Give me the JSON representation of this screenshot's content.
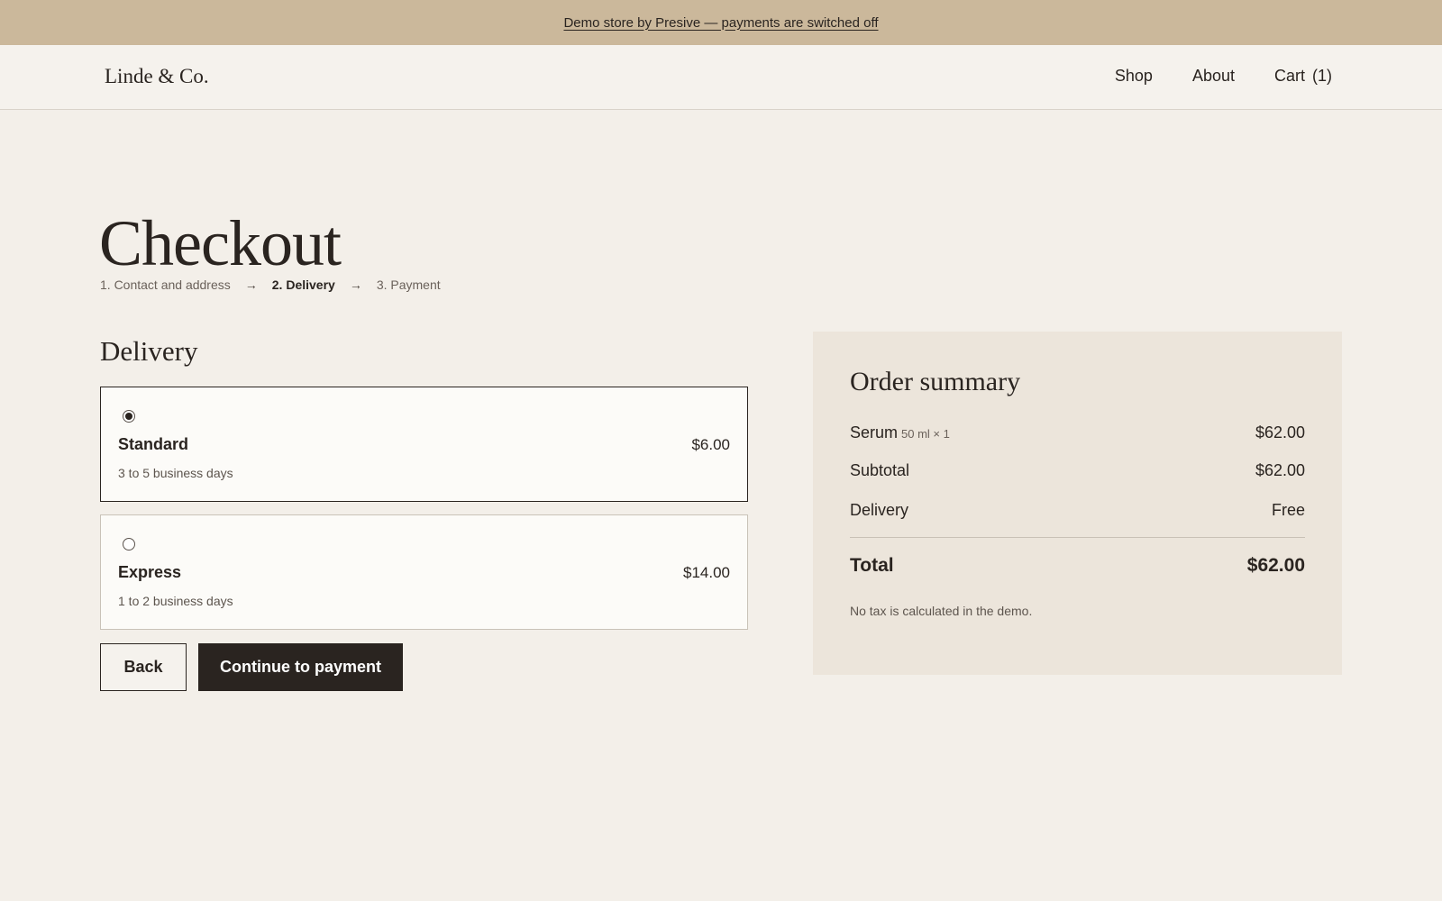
{
  "banner": {
    "text": "Demo store by Presive — payments are switched off"
  },
  "header": {
    "logo": "Linde & Co.",
    "nav": {
      "shop": "Shop",
      "about": "About",
      "cart": "Cart",
      "cart_count": "(1)"
    }
  },
  "checkout": {
    "title": "Checkout",
    "steps": {
      "step1": "1. Contact and address",
      "step2": "2. Delivery",
      "step3": "3. Payment",
      "arrow": "→"
    }
  },
  "delivery": {
    "title": "Delivery",
    "options": [
      {
        "name": "Standard",
        "time": "3 to 5 business days",
        "price": "$6.00",
        "selected": true
      },
      {
        "name": "Express",
        "time": "1 to 2 business days",
        "price": "$14.00",
        "selected": false
      }
    ],
    "back_label": "Back",
    "continue_label": "Continue to payment"
  },
  "summary": {
    "title": "Order summary",
    "item": {
      "name": "Serum",
      "detail": "50 ml × 1",
      "price": "$62.00"
    },
    "subtotal": {
      "label": "Subtotal",
      "value": "$62.00"
    },
    "delivery": {
      "label": "Delivery",
      "value": "Free"
    },
    "total": {
      "label": "Total",
      "value": "$62.00"
    },
    "note": "No tax is calculated in the demo."
  },
  "colors": {
    "banner": "#cbb89b",
    "background": "#f3efe9",
    "summary_background": "#ece5db",
    "primary_button": "#2a2420"
  }
}
